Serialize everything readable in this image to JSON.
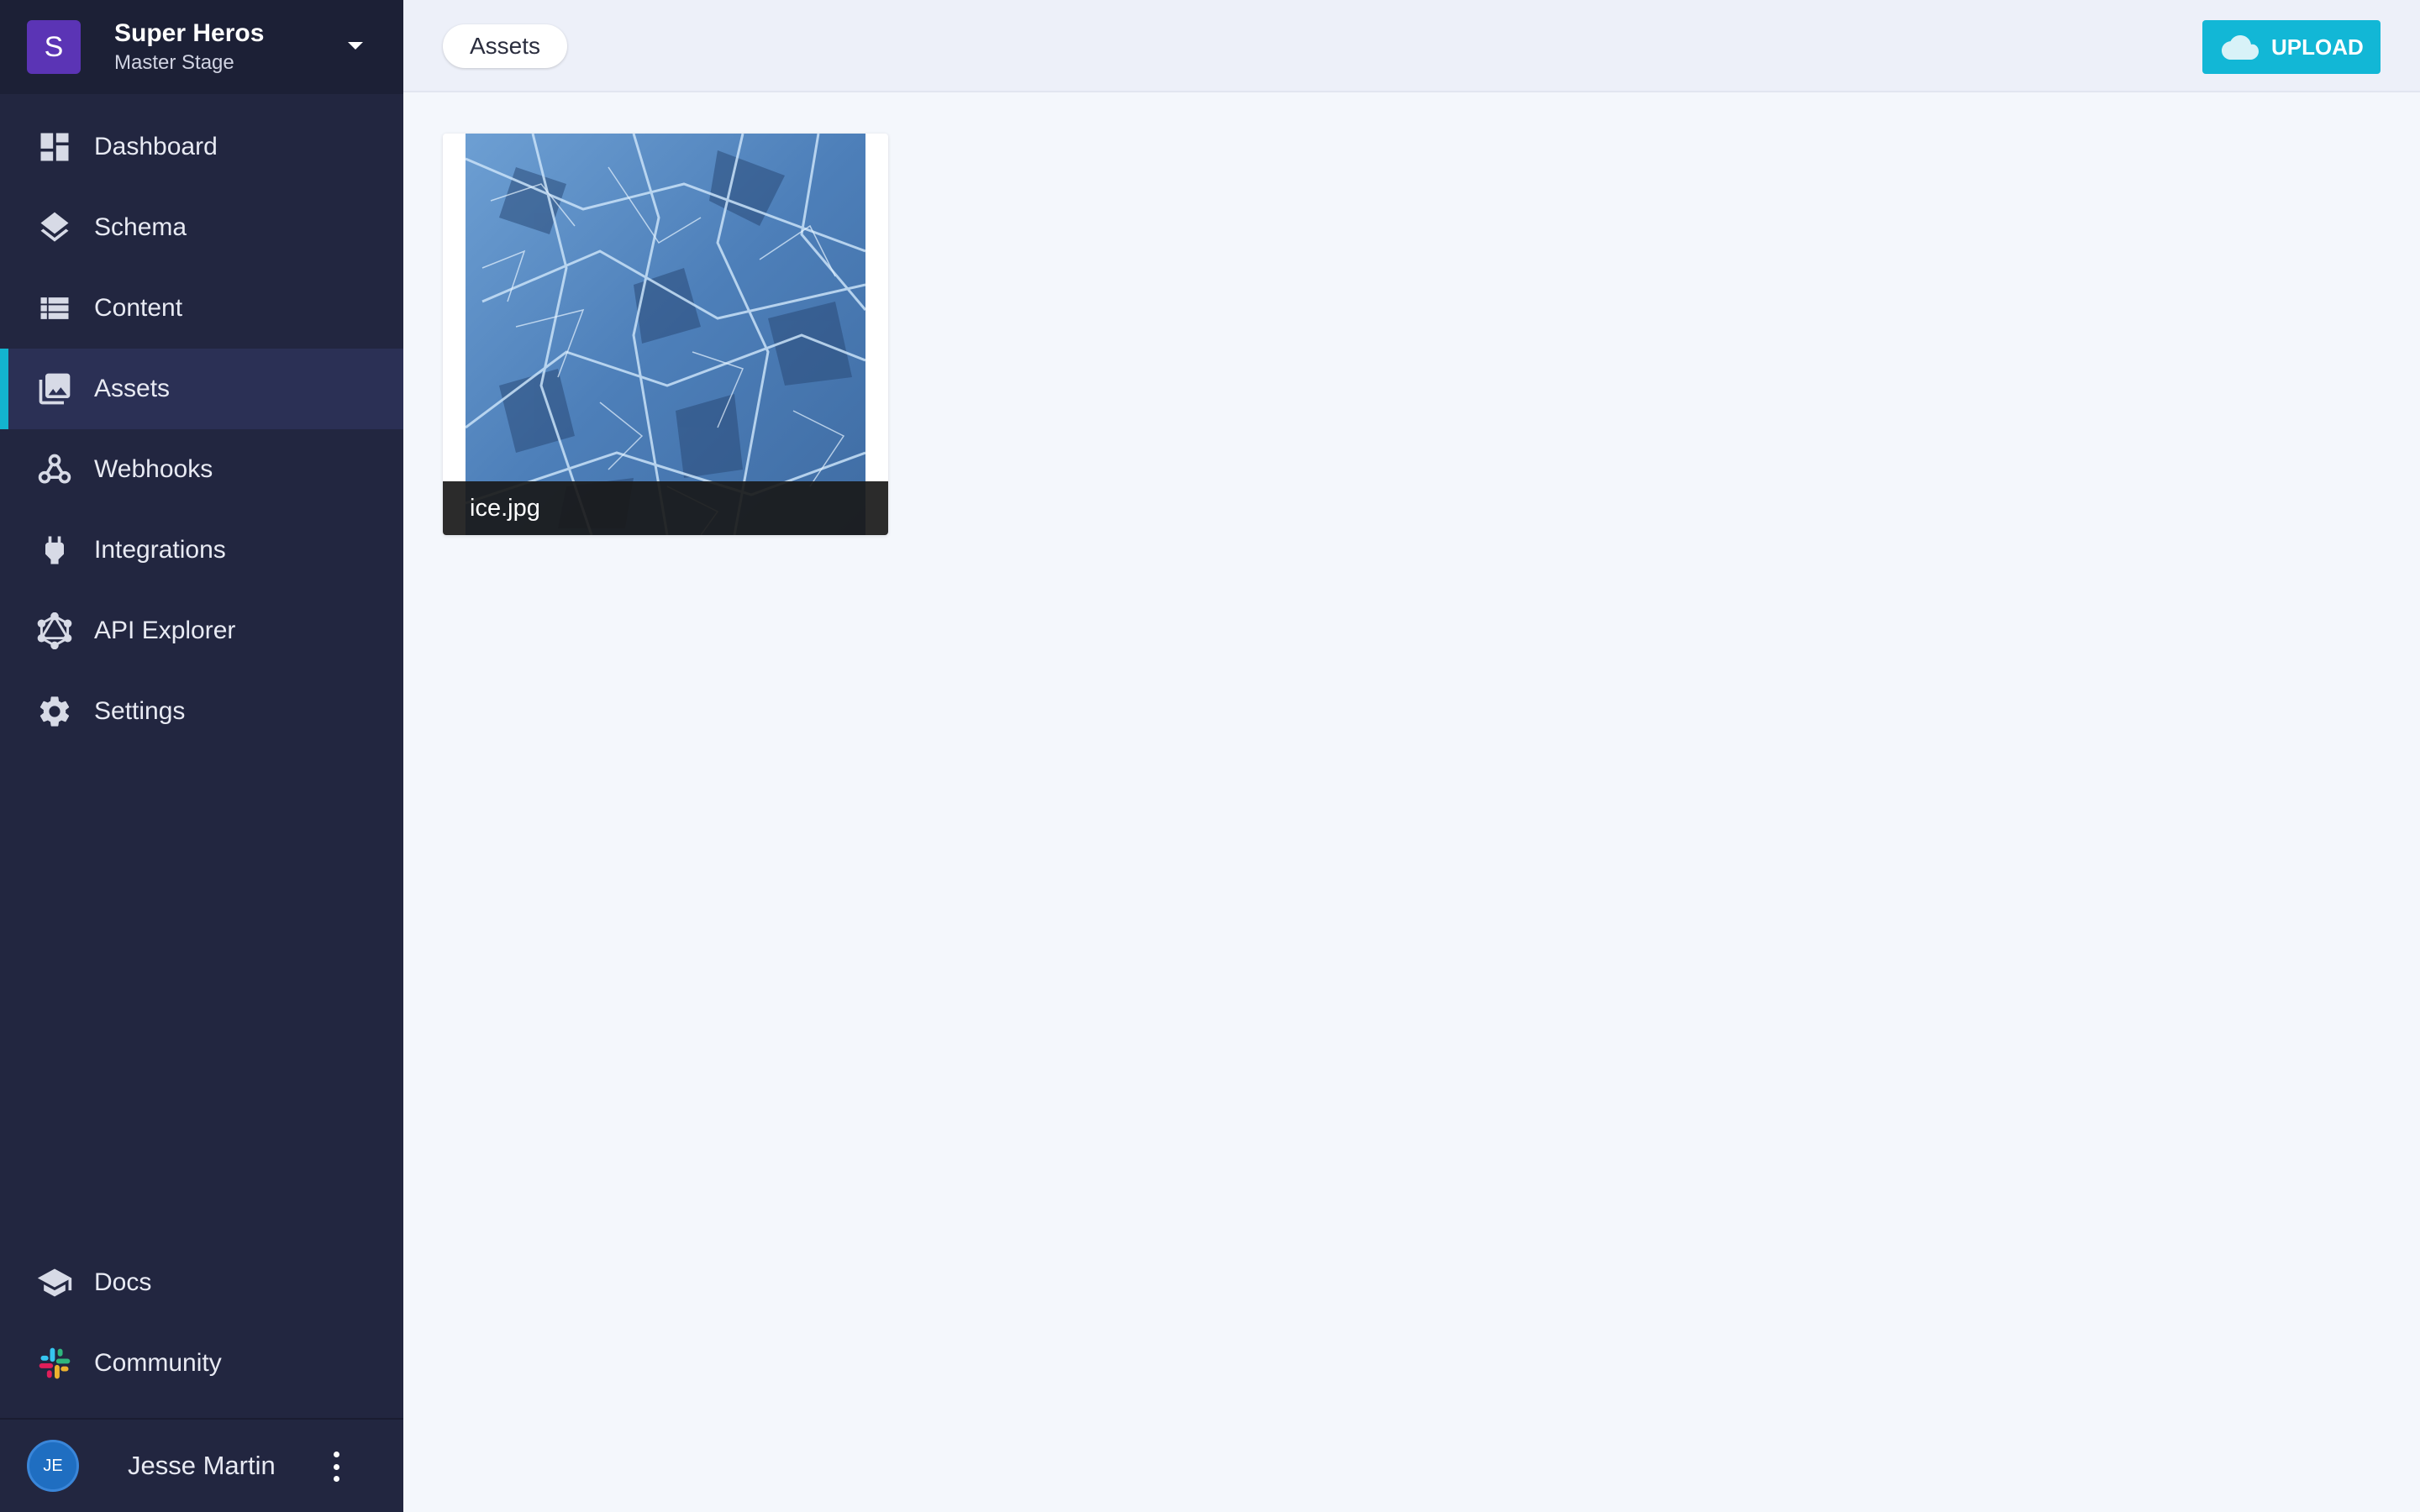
{
  "project": {
    "initial": "S",
    "name": "Super Heros",
    "stage": "Master Stage"
  },
  "nav": {
    "items": [
      {
        "label": "Dashboard",
        "icon": "dashboard-icon"
      },
      {
        "label": "Schema",
        "icon": "layers-icon"
      },
      {
        "label": "Content",
        "icon": "list-icon"
      },
      {
        "label": "Assets",
        "icon": "image-library-icon",
        "active": true
      },
      {
        "label": "Webhooks",
        "icon": "webhook-icon"
      },
      {
        "label": "Integrations",
        "icon": "plug-icon"
      },
      {
        "label": "API Explorer",
        "icon": "graphql-icon"
      },
      {
        "label": "Settings",
        "icon": "gear-icon"
      }
    ],
    "bottom": [
      {
        "label": "Docs",
        "icon": "graduation-cap-icon"
      },
      {
        "label": "Community",
        "icon": "slack-icon"
      }
    ]
  },
  "user": {
    "initials": "JE",
    "name": "Jesse Martin"
  },
  "topbar": {
    "breadcrumb": "Assets",
    "upload_label": "UPLOAD"
  },
  "assets": [
    {
      "filename": "ice.jpg"
    }
  ],
  "colors": {
    "sidebar": "#222640",
    "accent": "#13b4cf",
    "project_avatar": "#5b34b5",
    "upload_button": "#12b7d6"
  }
}
